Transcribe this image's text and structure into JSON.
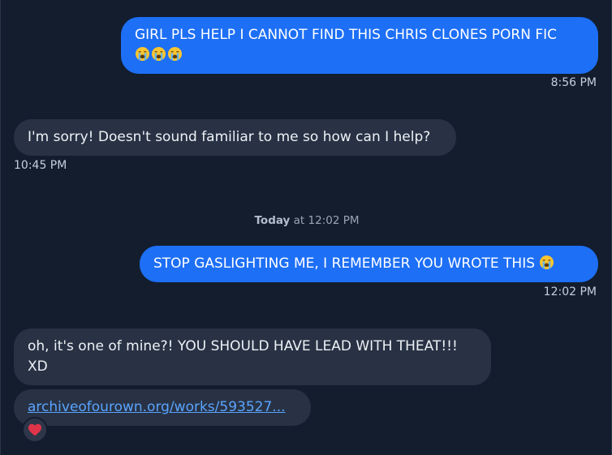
{
  "messages": [
    {
      "text": "GIRL PLS HELP I CANNOT FIND THIS CHRIS CLONES PORN FIC",
      "emoji": "😭😭😭",
      "time": "8:56 PM"
    },
    {
      "text": "I'm sorry! Doesn't sound familiar to me so how can I help?",
      "time": "10:45 PM"
    },
    {
      "text": "STOP GASLIGHTING ME, I REMEMBER YOU WROTE THIS",
      "emoji": "😭",
      "time": "12:02 PM"
    },
    {
      "text": "oh, it's one of mine?! YOU SHOULD HAVE LEAD WITH THEAT!!! XD"
    },
    {
      "link": "archiveofourown.org/works/593527..."
    }
  ],
  "day_separator": {
    "day": "Today",
    "time": "at 12:02 PM"
  },
  "reaction": {
    "icon": "heart-icon",
    "color": "#e0344a"
  }
}
